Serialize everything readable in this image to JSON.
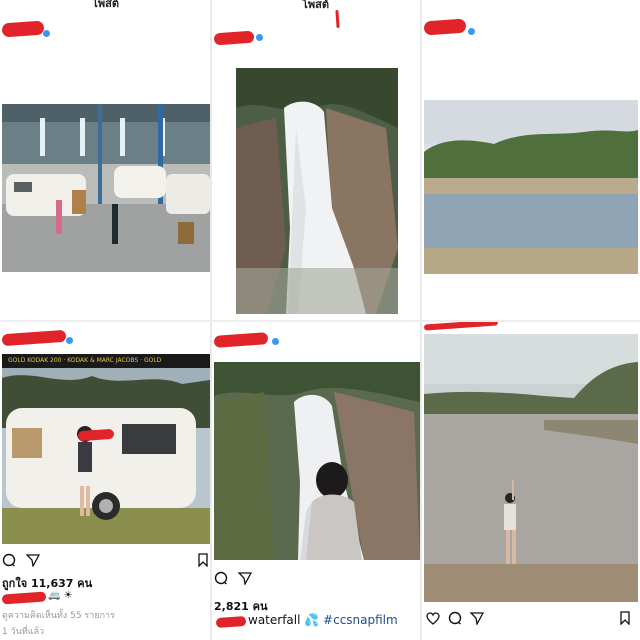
{
  "colors": {
    "redaction": "#e0242a",
    "verified": "#3897f0",
    "hashtag": "#1f4c8f"
  },
  "top_row": {
    "col1_header": "โพสต์",
    "col2_header": "โพสต์"
  },
  "bottom_row": {
    "col1": {
      "likes": "ถูกใจ 11,637 คน",
      "caption_emoji": "🚐 ☀",
      "view_comments": "ดูความคิดเห็นทั้ง 55 รายการ",
      "time": "1 วันที่แล้ว",
      "icons": [
        "comment-icon",
        "share-icon",
        "bookmark-icon"
      ]
    },
    "col2": {
      "likes": "2,821 คน",
      "caption_text": "waterfall",
      "caption_emoji": "💦",
      "hashtag": "#ccsnapfilm",
      "icons": [
        "comment-icon",
        "share-icon"
      ]
    },
    "col3": {
      "icons": [
        "heart-icon",
        "comment-icon",
        "share-icon",
        "bookmark-icon"
      ]
    }
  },
  "film_strip": {
    "text": "GOLD  KODAK 200  ·  KODAK & MARC JACOBS  ·  GOLD"
  }
}
